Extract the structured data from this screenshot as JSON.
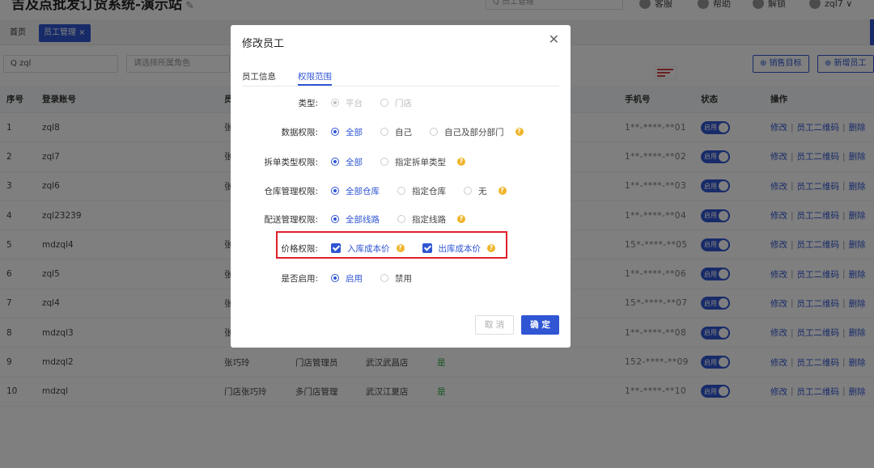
{
  "app": {
    "title": "吉及点批发订货系统-演示站",
    "edit_icon": "✎",
    "search_placeholder": "Q 员工管理",
    "menu": [
      {
        "label": "客服",
        "icon": "headset-icon"
      },
      {
        "label": "帮助",
        "icon": "help-icon"
      },
      {
        "label": "解锁",
        "icon": "lock-icon"
      },
      {
        "label": "zql7 ∨",
        "icon": "user-icon"
      }
    ]
  },
  "tabs": {
    "home": "首页",
    "staff": "员工管理 ×"
  },
  "filters": {
    "search_value": "Q zql",
    "role_placeholder": "请选择所属角色"
  },
  "actions": {
    "sales_target": "⊕ 销售目标",
    "add_staff": "⊕ 新增员工"
  },
  "table": {
    "headers": {
      "idx": "序号",
      "account": "登录账号",
      "col3": "员",
      "phone": "手机号",
      "status": "状态",
      "ops": "操作"
    },
    "rows": [
      {
        "idx": "1",
        "account": "zql8",
        "col3": "张",
        "phone": "1**-****-**01"
      },
      {
        "idx": "2",
        "account": "zql7",
        "col3": "张",
        "phone": "1**-****-**02"
      },
      {
        "idx": "3",
        "account": "zql6",
        "col3": "张",
        "phone": "1**-****-**03"
      },
      {
        "idx": "4",
        "account": "zql23239",
        "col3": "",
        "phone": "1**-****-**04"
      },
      {
        "idx": "5",
        "account": "mdzql4",
        "col3": "张",
        "phone": "15*-****-**05"
      },
      {
        "idx": "6",
        "account": "zql5",
        "col3": "张",
        "phone": "1**-****-**06"
      },
      {
        "idx": "7",
        "account": "zql4",
        "col3": "张",
        "phone": "15*-****-**07"
      },
      {
        "idx": "8",
        "account": "mdzql3",
        "col3": "张",
        "phone": "1**-****-**08"
      },
      {
        "idx": "9",
        "account": "mdzql2",
        "col3": "张巧玲",
        "role": "门店管理员",
        "store": "武汉武昌店",
        "flag": "是",
        "phone": "152-****-**09"
      },
      {
        "idx": "10",
        "account": "mdzql",
        "col3": "门店张巧玲",
        "role": "多门店管理",
        "store": "武汉江夏店",
        "flag": "是",
        "phone": "1**-****-**10"
      }
    ],
    "status_label": "启用",
    "ops": {
      "edit": "修改",
      "qrcode": "员工二维码",
      "delete": "删除",
      "sep": "|"
    }
  },
  "modal": {
    "title": "修改员工",
    "tabs": {
      "info": "员工信息",
      "scope": "权限范围"
    },
    "rows": {
      "type": {
        "label": "类型:",
        "opt1": "平台",
        "opt2": "门店"
      },
      "data": {
        "label": "数据权限:",
        "opt1": "全部",
        "opt2": "自己",
        "opt3": "自己及部分部门"
      },
      "split": {
        "label": "拆单类型权限:",
        "opt1": "全部",
        "opt2": "指定拆单类型"
      },
      "warehouse": {
        "label": "仓库管理权限:",
        "opt1": "全部仓库",
        "opt2": "指定仓库",
        "opt3": "无"
      },
      "delivery": {
        "label": "配送管理权限:",
        "opt1": "全部线路",
        "opt2": "指定线路"
      },
      "price": {
        "label": "价格权限:",
        "opt1": "入库成本价",
        "opt2": "出库成本价"
      },
      "enabled": {
        "label": "是否启用:",
        "opt1": "启用",
        "opt2": "禁用"
      }
    },
    "help": "?",
    "cancel": "取 消",
    "confirm": "确 定"
  },
  "colors": {
    "primary": "#3056d3",
    "help": "#f0b429",
    "highlight": "#e0202a",
    "success": "#2eaa44"
  }
}
